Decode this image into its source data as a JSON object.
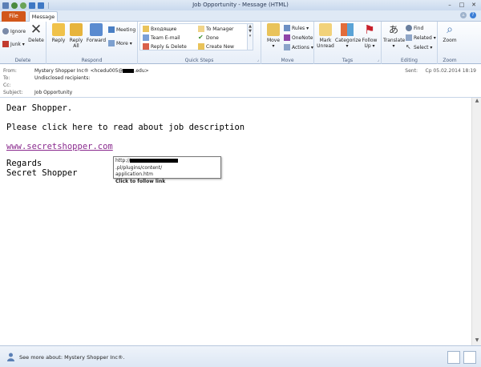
{
  "window": {
    "title": "Job  Opportunity - Message (HTML)",
    "minimize": "–",
    "maximize": "□",
    "close": "✕"
  },
  "tabs": {
    "file": "File",
    "message": "Message"
  },
  "ribbon": {
    "delete_group": {
      "label": "Delete",
      "ignore": "Ignore",
      "junk": "Junk ▾",
      "delete": "Delete"
    },
    "respond_group": {
      "label": "Respond",
      "reply": "Reply",
      "reply_all_1": "Reply",
      "reply_all_2": "All",
      "forward": "Forward",
      "meeting": "Meeting",
      "more": "More ▾"
    },
    "quicksteps_group": {
      "label": "Quick Steps",
      "items": [
        "Входящие",
        "To Manager",
        "Team E-mail",
        "Done",
        "Reply & Delete",
        "Create New"
      ]
    },
    "move_group": {
      "label": "Move",
      "move": "Move",
      "rules": "Rules ▾",
      "onenote": "OneNote",
      "actions": "Actions ▾"
    },
    "tags_group": {
      "label": "Tags",
      "mark_unread_1": "Mark",
      "mark_unread_2": "Unread",
      "categorize": "Categorize",
      "follow_up_1": "Follow",
      "follow_up_2": "Up ▾"
    },
    "editing_group": {
      "label": "Editing",
      "translate": "Translate",
      "find": "Find",
      "related": "Related ▾",
      "select": "Select ▾"
    },
    "zoom_group": {
      "label": "Zoom",
      "zoom": "Zoom"
    }
  },
  "header": {
    "from_label": "From:",
    "from_value": "Mystery Shopper Inc® <hcedu005@",
    "from_suffix": ".edu>",
    "to_label": "To:",
    "to_value": "Undisclosed recipients:",
    "cc_label": "Cc:",
    "cc_value": "",
    "subject_label": "Subject:",
    "subject_value": "Job  Opportunity",
    "sent_label": "Sent:",
    "sent_value": "Ср 05.02.2014 18:19"
  },
  "body": {
    "greeting": "Dear Shopper.",
    "line1": "Please click here to read about job description",
    "link": "www.secretshopper.com",
    "regards": "Regards",
    "signature": "Secret Shopper"
  },
  "tooltip": {
    "prefix": "http://",
    "suffix": ".pl/plugins/content/",
    "line2": "application.htm",
    "hint": "Click to follow link"
  },
  "footer": {
    "people_text": "See more about: Mystery Shopper Inc®."
  }
}
